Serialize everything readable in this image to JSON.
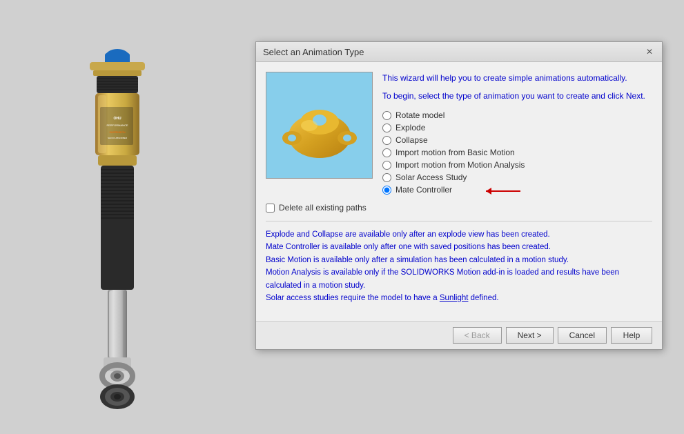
{
  "dialog": {
    "title": "Select an Animation Type",
    "close_label": "✕",
    "wizard_text_1": "This wizard will help you to create simple animations automatically.",
    "wizard_text_2": "To begin, select the type of animation you want to create and click Next.",
    "radio_options": [
      {
        "id": "rotate",
        "label": "Rotate model",
        "selected": false
      },
      {
        "id": "explode",
        "label": "Explode",
        "selected": false
      },
      {
        "id": "collapse",
        "label": "Collapse",
        "selected": false
      },
      {
        "id": "basic_motion",
        "label": "Import motion from Basic Motion",
        "selected": false
      },
      {
        "id": "motion_analysis",
        "label": "Import motion from Motion Analysis",
        "selected": false
      },
      {
        "id": "solar_access",
        "label": "Solar Access Study",
        "selected": false
      },
      {
        "id": "mate_controller",
        "label": "Mate Controller",
        "selected": true
      }
    ],
    "checkbox_label": "Delete all existing paths",
    "checkbox_checked": false,
    "info_lines": [
      "Explode and Collapse are available only after an explode view has been created.",
      "Mate Controller is available only after one with saved positions has been created.",
      "Basic Motion is available only after a simulation has been calculated in a motion study.",
      "Motion Analysis is available only if the SOLIDWORKS Motion add-in is loaded and results have been calculated in a motion study.",
      "Solar access studies require the model to have a Sunlight defined."
    ],
    "sunlight_link": "Sunlight",
    "buttons": {
      "back": "< Back",
      "next": "Next >",
      "cancel": "Cancel",
      "help": "Help"
    }
  }
}
